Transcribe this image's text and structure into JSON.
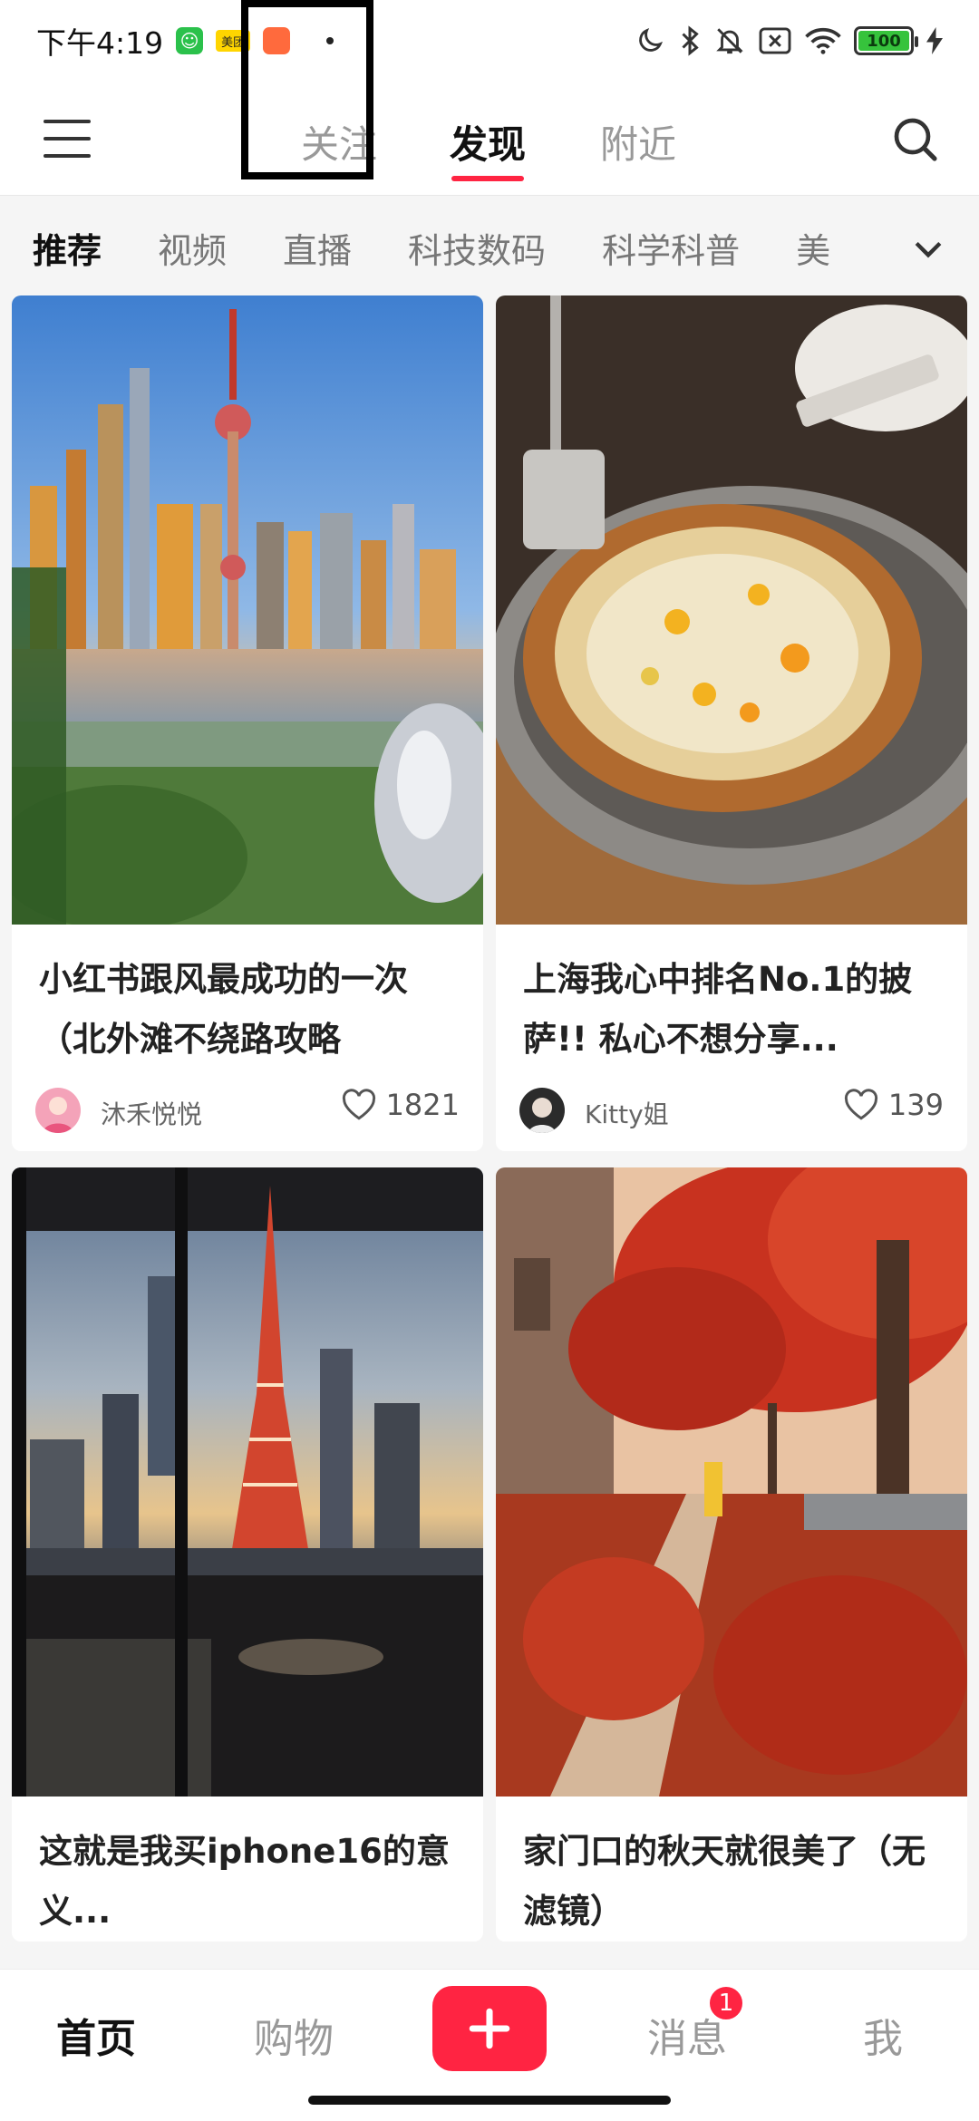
{
  "status_bar": {
    "time": "下午4:19",
    "app_icons": [
      "wechat-icon",
      "meituan-icon",
      "taobao-icon"
    ],
    "meituan_label": "美团",
    "battery": "100"
  },
  "top_nav": {
    "tabs": [
      {
        "label": "关注",
        "active": false
      },
      {
        "label": "发现",
        "active": true
      },
      {
        "label": "附近",
        "active": false
      }
    ],
    "accent_color": "#ff2442"
  },
  "categories": {
    "items": [
      "推荐",
      "视频",
      "直播",
      "科技数码",
      "科学科普",
      "美"
    ],
    "active_index": 0
  },
  "feed": {
    "cards": [
      {
        "title": "小红书跟风最成功的一次（北外滩不绕路攻略",
        "author": "沐禾悦悦",
        "likes": "1821",
        "image": "shanghai-skyline-photo"
      },
      {
        "title": "上海我心中排名No.1的披萨!! 私心不想分享...",
        "author": "Kitty姐",
        "likes": "139",
        "image": "pizza-photo"
      },
      {
        "title": "这就是我买iphone16的意义...",
        "author": "",
        "likes": "",
        "image": "tokyo-tower-photo"
      },
      {
        "title": "家门口的秋天就很美了（无滤镜）",
        "author": "",
        "likes": "",
        "image": "autumn-street-photo"
      }
    ]
  },
  "bottom_bar": {
    "items": [
      {
        "label": "首页",
        "active": true
      },
      {
        "label": "购物",
        "active": false
      },
      {
        "label": "消息",
        "active": false,
        "badge": "1"
      },
      {
        "label": "我",
        "active": false
      }
    ]
  }
}
